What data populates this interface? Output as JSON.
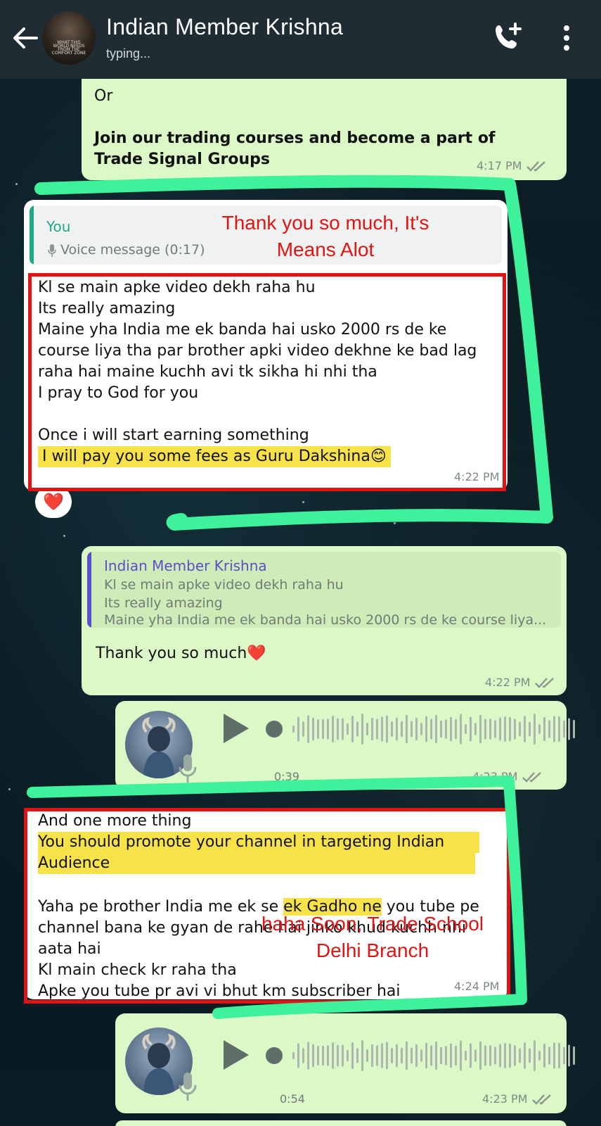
{
  "header": {
    "contact_name": "Indian Member Krishna",
    "status": "typing...",
    "avatar_caption": "WHAT THIS WORLD NEEDS FROM THE COMFORT ZONE"
  },
  "messages": {
    "m1": {
      "line_or": "Or",
      "text": "Join our trading courses and become a part of Trade Signal Groups",
      "time": "4:17 PM"
    },
    "m2": {
      "quote_author": "You",
      "quote_body": "Voice message (0:17)",
      "text_lines": [
        "Kl se main apke video dekh raha hu",
        "Its really amazing",
        "Maine yha India me ek banda hai usko 2000 rs de ke",
        "course liya tha par brother apki video dekhne ke bad lag",
        "raha hai maine kuchh avi tk sikha hi nhi tha",
        "I pray to God for you",
        "Once i will start earning something"
      ],
      "highlight_line": "I will pay you some fees as Guru Dakshina😊",
      "time": "4:22 PM",
      "reaction": "❤️"
    },
    "m3": {
      "quote_author": "Indian Member Krishna",
      "quote_lines": [
        "Kl se main apke video dekh raha hu",
        "Its really amazing",
        "Maine yha India me ek banda hai usko 2000 rs de ke course liya..."
      ],
      "text": "Thank you so much❤️",
      "time": "4:22 PM"
    },
    "voice1": {
      "duration": "0:39",
      "time": "4:23 PM"
    },
    "m4": {
      "line1": "And one more thing",
      "highlight_lines": [
        "You should promote your channel in targeting Indian",
        "Audience"
      ],
      "line_yaha_a": "Yaha pe brother India me ek se ",
      "line_yaha_hl": "ek Gadho ne",
      "line_yaha_b": " you tube pe",
      "lines_rest": [
        "channel bana ke gyan de rahe hai jinko khud kuchh nhi",
        "aata hai",
        "Kl main check kr raha tha",
        "Apke you tube pr avi vi bhut km subscriber hai"
      ],
      "time": "4:24 PM"
    },
    "voice2": {
      "duration": "0:54",
      "time": "4:23 PM"
    }
  },
  "annotations": {
    "note1": "Thank you so much, It's Means Alot",
    "note2": "haha Soon, Trade School Delhi Branch"
  },
  "colors": {
    "header_bg": "#1f2c34",
    "sent_bubble": "#dcf8c6",
    "received_bubble": "#ffffff",
    "annotation_red": "#e11414",
    "annotation_green": "#3df29a",
    "highlight_yellow": "#f7e24a",
    "quote_me": "#1fa885",
    "quote_contact": "#5b4fc9"
  }
}
